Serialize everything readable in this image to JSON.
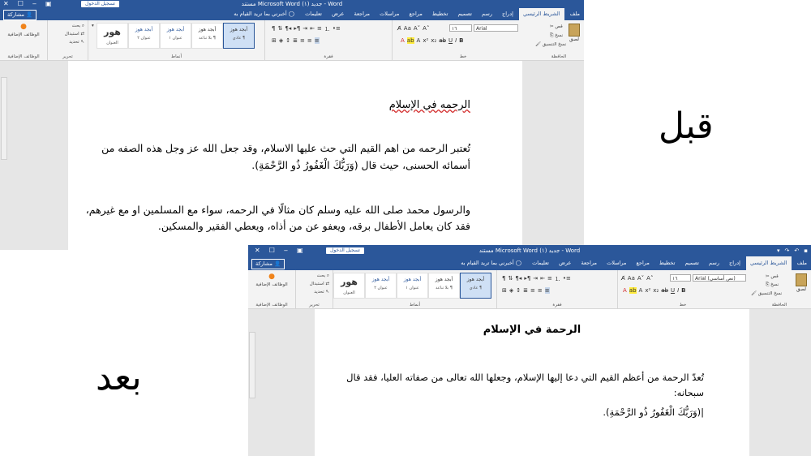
{
  "labels": {
    "before": "قبل",
    "after": "بعد"
  },
  "colors": {
    "word_blue": "#2b579a",
    "ribbon_bg": "#f3f3f3",
    "doc_bg": "#e6e6e6",
    "spell_error": "#d32f2f"
  },
  "titlebar": {
    "doc_title": "مستند Microsoft Word جديد (١) - Word",
    "signin": "تسجيل الدخول"
  },
  "tabs": [
    "ملف",
    "الشريط الرئيسي",
    "إدراج",
    "رسم",
    "تصميم",
    "تخطيط",
    "مراجع",
    "مراسلات",
    "مراجعة",
    "عرض",
    "تعليمات"
  ],
  "tellme": "أخبرني بما تريد القيام به",
  "share": "مشاركة",
  "ribbon": {
    "clipboard": {
      "paste": "لصق",
      "cut": "قص",
      "copy": "نسخ",
      "format_painter": "نسخ التنسيق",
      "group": "الحافظة"
    },
    "font": {
      "name_before": "Arial",
      "name_after": "Arial (نص أساسي)",
      "size": "١٦",
      "group": "خط"
    },
    "paragraph": {
      "group": "فقرة"
    },
    "styles": {
      "items": [
        {
          "sample": "أبجد هوز",
          "name": "¶ عادي"
        },
        {
          "sample": "أبجد هوز",
          "name": "¶ بلا تباعد"
        },
        {
          "sample": "أبجد هوز",
          "name": "عنوان ١"
        },
        {
          "sample": "أبجد هوز",
          "name": "عنوان ٢"
        },
        {
          "sample": "هور",
          "name": "العنوان"
        }
      ],
      "group": "أنماط"
    },
    "editing": {
      "find": "بحث",
      "replace": "استبدال",
      "select": "تحديد",
      "group": "تحرير"
    },
    "addins": {
      "label": "الوظائف الإضافية",
      "group": "الوظائف الإضافية"
    }
  },
  "before_doc": {
    "title": "الرحمه في الإسلام",
    "p1_l1": "تُعتبر الرحمه من اهم القيم التي حث عليها الاسلام، وقد جعل الله عز وجل هذه الصفه من",
    "p1_l2": "أسمائه الحسنى، حيث قال (وَرَبُّكَ الْغَفُورُ ذُو الرَّحْمَةِ).",
    "p2_l1": "والرسول محمد صلى الله عليه وسلم كان مثالًا في الرحمه، سواء مع المسلمين او مع غيرهم،",
    "p2_l2": "فقد كان يعامل الأطفال برقه، ويعفو عن من أذاه، ويعطي الفقير والمسكين."
  },
  "after_doc": {
    "title": "الرحمة في الإسلام",
    "p1_l1": "تُعدّ الرحمة من أعظم القيم التي دعا إليها الإسلام، وجعلها الله تعالى من صفاته العليا، فقد قال",
    "p1_l2": "سبحانه:",
    "p1_l3": "(وَرَبُّكَ الْغَفُورُ ذُو الرَّحْمَةِ)."
  }
}
